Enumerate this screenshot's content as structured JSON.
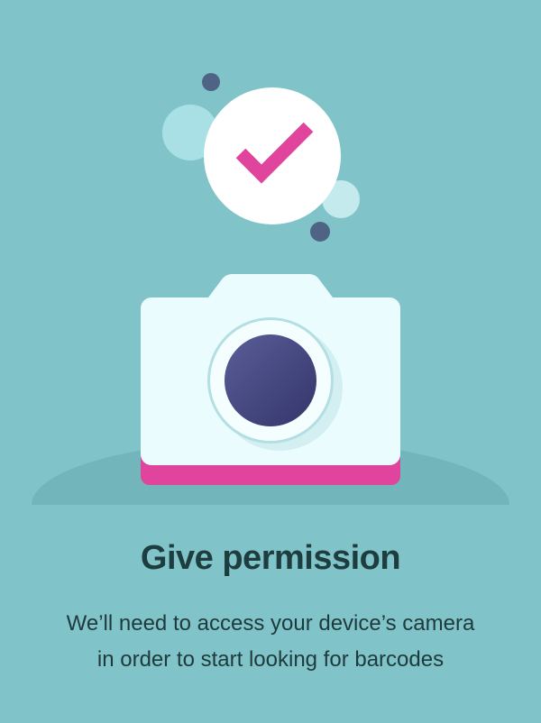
{
  "screen": {
    "title": "Give permission",
    "description_lines": [
      "We’ll need to access your device’s camera",
      "in order to start looking for barcodes"
    ]
  },
  "illustration": {
    "icons": [
      "check-mark-icon",
      "camera-icon"
    ],
    "colors": {
      "background": "#80c4c9",
      "accent_pink": "#e0449c",
      "camera_body": "#eafcfd",
      "lens": "#4a4d85",
      "bubble_dark": "#4f6485",
      "bubble_light": "#a9e0e5"
    }
  }
}
